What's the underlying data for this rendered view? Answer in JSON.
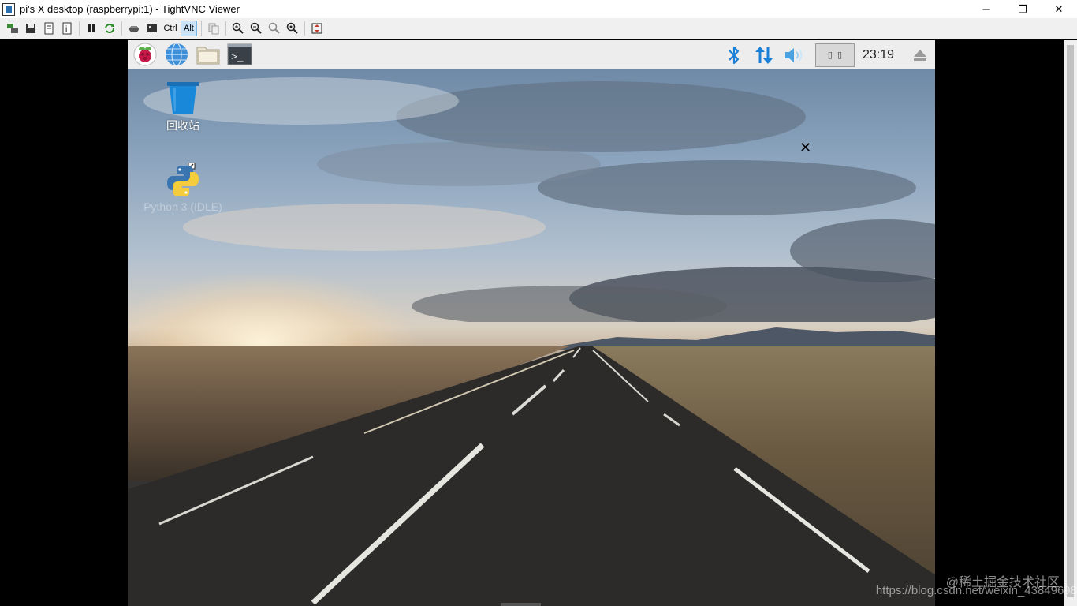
{
  "window": {
    "title": "pi's X desktop (raspberrypi:1) - TightVNC Viewer",
    "minimize": "─",
    "restore": "❐",
    "close": "✕"
  },
  "toolbar": {
    "ctrl_label": "Ctrl",
    "alt_label": "Alt",
    "items": [
      "new-connection-icon",
      "save-icon",
      "options-icon",
      "info-icon",
      "pause-icon",
      "refresh-icon",
      "ctrl-alt-del-icon",
      "ctrl-esc-icon",
      "ctrl-toggle",
      "alt-toggle",
      "transfer-files-icon",
      "zoom-in-icon",
      "zoom-out-icon",
      "zoom-100-icon",
      "zoom-auto-icon",
      "fullscreen-icon"
    ]
  },
  "panel": {
    "launchers": [
      "raspberry-menu-icon",
      "web-browser-icon",
      "file-manager-icon",
      "terminal-icon"
    ],
    "terminal_glyph": ">_",
    "workspace_glyphs": [
      "▯",
      "▯"
    ],
    "clock": "23:19",
    "colors": {
      "bluetooth": "#1a7fd6",
      "network": "#1a7fd6",
      "volume": "#4aa3e0"
    }
  },
  "desktop": {
    "icons": [
      {
        "label": "回收站"
      },
      {
        "label": "Python 3 (IDLE)"
      }
    ]
  },
  "watermark": {
    "line1": "@稀土掘金技术社区",
    "line2": "https://blog.csdn.net/weixin_43849698"
  }
}
